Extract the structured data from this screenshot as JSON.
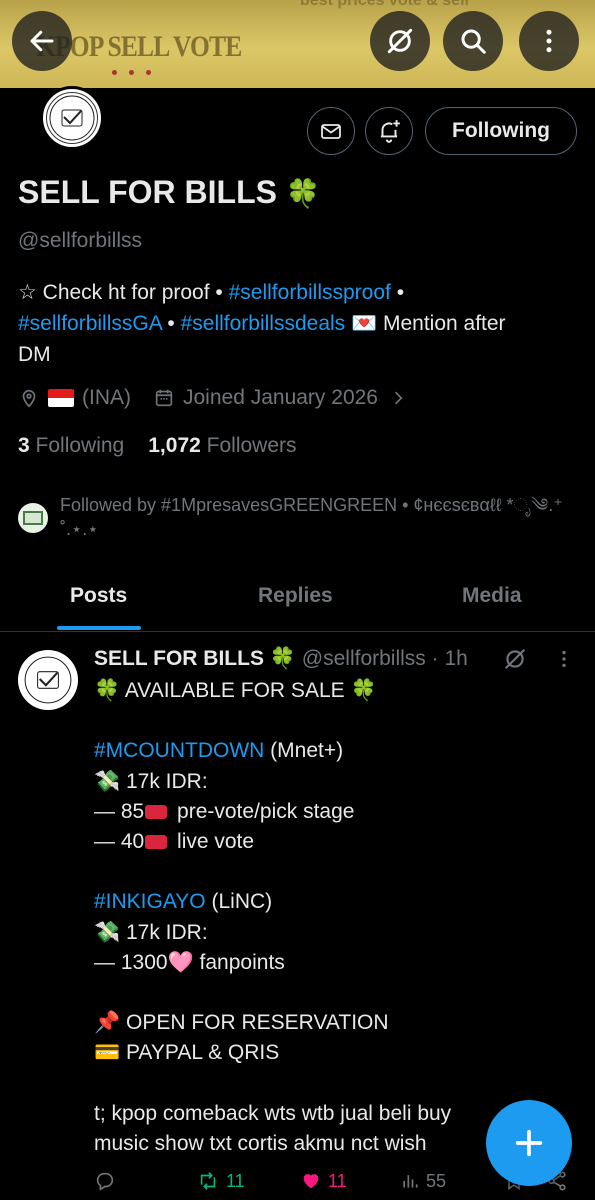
{
  "banner": {
    "title": "KPOP SELL VOTE",
    "top_text": "best prices vote & sell"
  },
  "header": {
    "back_icon": "arrow-left-icon",
    "grok_icon": "grok-icon",
    "search_icon": "search-icon",
    "more_icon": "more-vertical-icon"
  },
  "profile": {
    "name": "SELL FOR BILLS",
    "name_emoji": "🍀",
    "handle": "@sellforbillss",
    "bio_parts": {
      "star": "☆ Check ht for proof • ",
      "tag1": "#sellforbillssproof",
      "sep1": " •",
      "tag2": "#sellforbillssGA",
      "sep2": " • ",
      "tag3": "#sellforbillssdeals",
      "after": " 💌 Mention after",
      "tail": "DM"
    },
    "location": "(INA)",
    "joined": "Joined January 2026",
    "following_count": "3",
    "following_label": "Following",
    "followers_count": "1,072",
    "followers_label": "Followers",
    "followed_by": "Followed by #1MpresavesGREENGREEN • ¢нєєѕєвαℓℓ *ೃ༄.⁺ ˚.⋆.⋆"
  },
  "actions": {
    "message_icon": "mail-icon",
    "notify_icon": "bell-plus-icon",
    "following_button": "Following"
  },
  "tabs": [
    "Posts",
    "Replies",
    "Media"
  ],
  "post": {
    "author": "SELL FOR BILLS 🍀",
    "handle": "@sellforbillss",
    "time": "· 1h",
    "lines": {
      "l1": "🍀 AVAILABLE FOR SALE 🍀",
      "l3_tag": "#MCOUNTDOWN",
      "l3_rest": " (Mnet+)",
      "l4": "💸 17k IDR:",
      "l5_a": "— 85",
      "l5_b": " pre-vote/pick stage",
      "l6_a": "— 40",
      "l6_b": " live vote",
      "l8_tag": "#INKIGAYO",
      "l8_rest": " (LiNC)",
      "l9": "💸 17k IDR:",
      "l10_a": "— 1300",
      "l10_b": "🩷 fanpoints",
      "l12": "📌 OPEN FOR RESERVATION",
      "l13": "💳 PAYPAL & QRIS",
      "l15": "t; kpop comeback wts wtb jual beli buy",
      "l16": "music show txt cortis akmu nct wish"
    },
    "reposts": "11",
    "likes": "11",
    "views": "55"
  },
  "colors": {
    "accent": "#1d9bf0",
    "muted": "#71767b",
    "text": "#e7e9ea",
    "repost": "#00ba7c",
    "like": "#f91880",
    "banner": "#dcc766"
  }
}
